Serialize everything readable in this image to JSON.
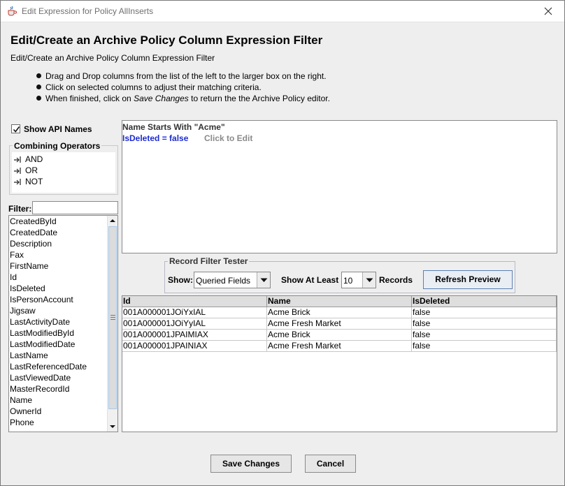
{
  "window": {
    "title": "Edit Expression for Policy AllInserts"
  },
  "header": {
    "title": "Edit/Create an Archive Policy Column Expression Filter",
    "subtitle": "Edit/Create an Archive Policy Column Expression Filter",
    "instructions": [
      {
        "text": "Drag and Drop columns from the list of the left to the larger box on the right."
      },
      {
        "text": "Click on selected columns to adjust their matching criteria."
      },
      {
        "pre": "When finished, click on ",
        "emph": "Save Changes",
        "post": " to return the the Archive Policy editor."
      }
    ]
  },
  "left": {
    "show_api_names": {
      "label": "Show API Names",
      "checked": true
    },
    "operators": {
      "title": "Combining Operators",
      "items": [
        "AND",
        "OR",
        "NOT"
      ]
    },
    "filter": {
      "label": "Filter:",
      "value": ""
    },
    "columns": [
      "CreatedById",
      "CreatedDate",
      "Description",
      "Fax",
      "FirstName",
      "Id",
      "IsDeleted",
      "IsPersonAccount",
      "Jigsaw",
      "LastActivityDate",
      "LastModifiedById",
      "LastModifiedDate",
      "LastName",
      "LastReferencedDate",
      "LastViewedDate",
      "MasterRecordId",
      "Name",
      "OwnerId",
      "Phone"
    ]
  },
  "expression": {
    "line1": "Name Starts With \"Acme\"",
    "line2": "IsDeleted = false",
    "hint": "Click to Edit"
  },
  "tester": {
    "title": "Record Filter Tester",
    "show_label": "Show:",
    "show_value": "Queried Fields",
    "show_at_least_label": "Show At Least",
    "count_value": "10",
    "records_label": "Records",
    "refresh_label": "Refresh Preview"
  },
  "results": {
    "columns": [
      "Id",
      "Name",
      "IsDeleted"
    ],
    "rows": [
      [
        "001A000001JOiYxIAL",
        "Acme Brick",
        "false"
      ],
      [
        "001A000001JOiYyIAL",
        "Acme Fresh Market",
        "false"
      ],
      [
        "001A000001JPAIMIAX",
        "Acme Brick",
        "false"
      ],
      [
        "001A000001JPAINIAX",
        "Acme Fresh Market",
        "false"
      ]
    ]
  },
  "footer": {
    "save_label": "Save Changes",
    "cancel_label": "Cancel"
  },
  "icons": {
    "app": "java-cup-icon",
    "close": "close-icon",
    "checkbox": "checkmark-icon",
    "operator": "operator-arrow-icon",
    "combo": "chevron-down-icon",
    "scroll_up": "arrow-up-icon",
    "scroll_down": "arrow-down-icon"
  },
  "colors": {
    "expression_active": "#1d2bd0",
    "hint": "#8a8a8a",
    "window_bg": "#eeeeee"
  }
}
